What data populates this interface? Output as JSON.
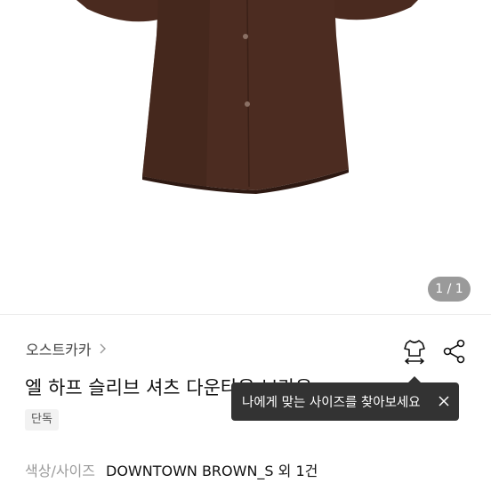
{
  "gallery": {
    "image_alt": "brown half-sleeve shirt blouse",
    "counter": "1 / 1"
  },
  "product": {
    "brand": "오스트카카",
    "title": "엘 하프 슬리브 셔츠 다운타운 브라운",
    "badge": "단독",
    "option_label": "색상/사이즈",
    "option_value": "DOWNTOWN BROWN_S 외 1건"
  },
  "tooltip": {
    "text": "나에게 맞는 사이즈를 찾아보세요"
  },
  "icons": {
    "brand_chevron": "chevron-right-icon",
    "size_guide": "shirt-size-icon",
    "share": "share-icon",
    "tooltip_close": "close-icon"
  },
  "colors": {
    "shirt": "#4a2a1f",
    "counter_bg": "#9a9a9a",
    "tooltip_bg": "#333333"
  }
}
